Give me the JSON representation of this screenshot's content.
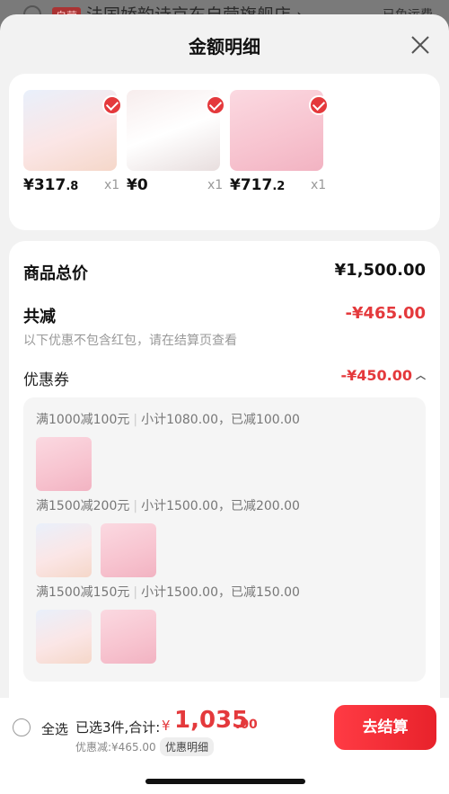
{
  "background": {
    "store_tag": "自营",
    "store_name": "法国娇韵诗京东自营旗舰店 ›",
    "shipping": "已免运费"
  },
  "sheet": {
    "title": "金额明细"
  },
  "products": [
    {
      "price_int": "¥317",
      "price_dec": ".8",
      "qty": "x1",
      "theme": "clarins"
    },
    {
      "price_int": "¥0",
      "price_dec": "",
      "qty": "x1",
      "theme": "sample"
    },
    {
      "price_int": "¥717",
      "price_dec": ".2",
      "qty": "x1",
      "theme": "lancome"
    }
  ],
  "summary": {
    "total_label": "商品总价",
    "total_value": "¥1,500.00",
    "discount_label": "共减",
    "discount_value": "-¥465.00",
    "note": "以下优惠不包含红包，请在结算页查看",
    "coupon_label": "优惠券",
    "coupon_value": "-¥450.00"
  },
  "coupons": [
    {
      "rule": "满1000减100元",
      "detail": "小计1080.00，已减100.00",
      "items": [
        "lancome"
      ]
    },
    {
      "rule": "满1500减200元",
      "detail": "小计1500.00，已减200.00",
      "items": [
        "clarins",
        "lancome"
      ]
    },
    {
      "rule": "满1500减150元",
      "detail": "小计1500.00，已减150.00",
      "items": [
        "clarins",
        "lancome"
      ]
    }
  ],
  "footer": {
    "select_all": "全选",
    "selected": "已选3件,合计:",
    "currency": "¥",
    "total_int": "1,035",
    "total_dec": ".00",
    "discount": "优惠减:¥465.00",
    "detail_link": "优惠明细",
    "checkout": "去结算"
  },
  "colors": {
    "accent_red": "#e4393c",
    "sheet_bg": "#f2f2f2"
  }
}
